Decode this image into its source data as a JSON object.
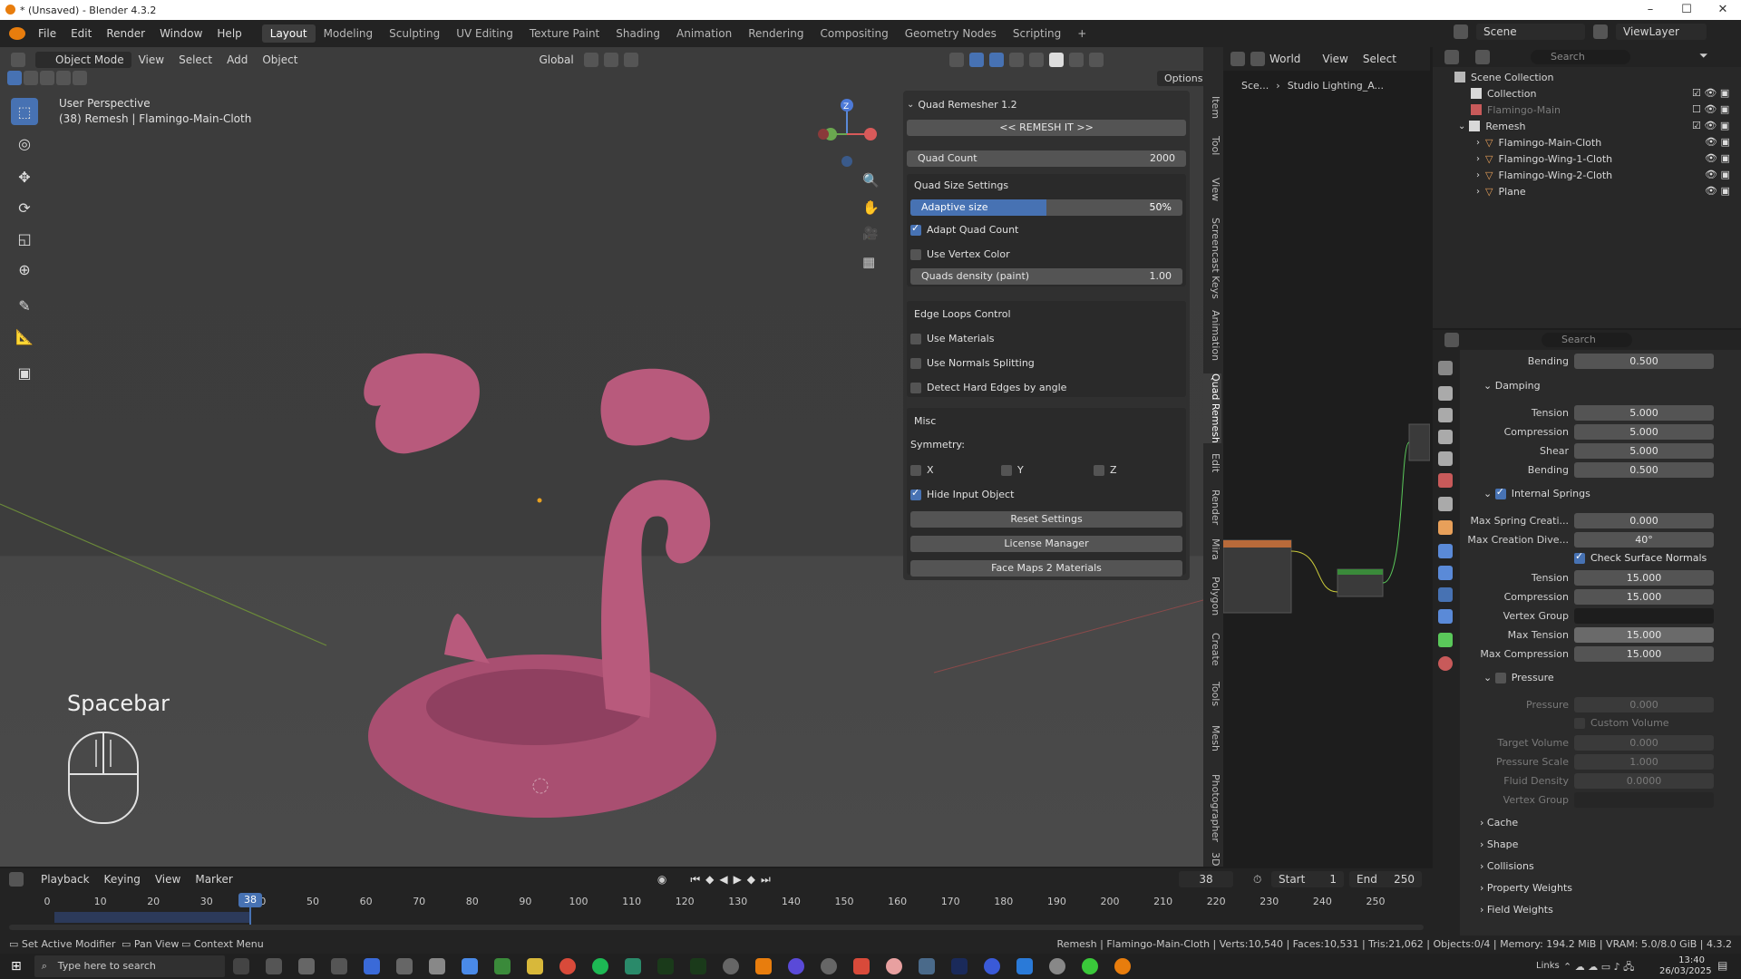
{
  "window": {
    "title": "* (Unsaved) - Blender 4.3.2"
  },
  "menus": [
    "File",
    "Edit",
    "Render",
    "Window",
    "Help"
  ],
  "workspaces": [
    "Layout",
    "Modeling",
    "Sculpting",
    "UV Editing",
    "Texture Paint",
    "Shading",
    "Animation",
    "Rendering",
    "Compositing",
    "Geometry Nodes",
    "Scripting"
  ],
  "scene": {
    "name": "Scene",
    "view_layer": "ViewLayer"
  },
  "viewport": {
    "mode": "Object Mode",
    "menus": [
      "View",
      "Select",
      "Add",
      "Object"
    ],
    "orientation": "Global",
    "options": "Options",
    "perspective": "User Perspective",
    "object_info": "(38) Remesh | Flamingo-Main-Cloth",
    "key_hint": "Spacebar"
  },
  "side_tabs": [
    "Item",
    "Tool",
    "View",
    "Screencast Keys",
    "Animation",
    "Quad Remesh",
    "Edit",
    "Render",
    "Mira",
    "Polygon",
    "Create",
    "Tools",
    "Mesh",
    "Photographer",
    "3D"
  ],
  "quad_remesher": {
    "title": "Quad Remesher 1.2",
    "remesh_button": "<< REMESH IT >>",
    "quad_count_label": "Quad Count",
    "quad_count_value": "2000",
    "size_settings_title": "Quad Size Settings",
    "adaptive_label": "Adaptive size",
    "adaptive_value": "50%",
    "adaptive_fraction": 0.5,
    "adapt_quad_count": "Adapt Quad Count",
    "use_vertex_color": "Use Vertex Color",
    "quads_density_label": "Quads density (paint)",
    "quads_density_value": "1.00",
    "edge_loops_title": "Edge Loops Control",
    "use_materials": "Use Materials",
    "use_normals_splitting": "Use Normals Splitting",
    "detect_hard_edges": "Detect Hard Edges by angle",
    "misc_title": "Misc",
    "symmetry_label": "Symmetry:",
    "sym_x": "X",
    "sym_y": "Y",
    "sym_z": "Z",
    "hide_input_object": "Hide Input Object",
    "reset_settings": "Reset Settings",
    "license_manager": "License Manager",
    "face_maps": "Face Maps 2 Materials"
  },
  "node_editor": {
    "world": "World",
    "menus": [
      "View",
      "Select"
    ],
    "breadcrumb_scene": "Sce...",
    "breadcrumb_world": "Studio Lighting_A..."
  },
  "outliner": {
    "search_placeholder": "Search",
    "scene_collection": "Scene Collection",
    "items": [
      {
        "name": "Collection",
        "depth": 1
      },
      {
        "name": "Flamingo-Main",
        "depth": 1
      },
      {
        "name": "Remesh",
        "depth": 1
      },
      {
        "name": "Flamingo-Main-Cloth",
        "depth": 2
      },
      {
        "name": "Flamingo-Wing-1-Cloth",
        "depth": 2
      },
      {
        "name": "Flamingo-Wing-2-Cloth",
        "depth": 2
      },
      {
        "name": "Plane",
        "depth": 2
      }
    ]
  },
  "properties": {
    "search_placeholder": "Search",
    "bending_top_label": "Bending",
    "bending_top_value": "0.500",
    "damping_title": "Damping",
    "damping": [
      {
        "label": "Tension",
        "value": "5.000"
      },
      {
        "label": "Compression",
        "value": "5.000"
      },
      {
        "label": "Shear",
        "value": "5.000"
      },
      {
        "label": "Bending",
        "value": "0.500"
      }
    ],
    "internal_springs_title": "Internal Springs",
    "max_spring_label": "Max Spring Creati...",
    "max_spring_value": "0.000",
    "max_creation_label": "Max Creation Dive...",
    "max_creation_value": "40°",
    "check_surface_normals": "Check Surface Normals",
    "springs": [
      {
        "label": "Tension",
        "value": "15.000"
      },
      {
        "label": "Compression",
        "value": "15.000"
      }
    ],
    "vertex_group_label": "Vertex Group",
    "max_tension_label": "Max Tension",
    "max_tension_value": "15.000",
    "max_compression_label": "Max Compression",
    "max_compression_value": "15.000",
    "pressure_title": "Pressure",
    "pressure_label": "Pressure",
    "pressure_value": "0.000",
    "custom_volume": "Custom Volume",
    "target_volume_label": "Target Volume",
    "target_volume_value": "0.000",
    "pressure_scale_label": "Pressure Scale",
    "pressure_scale_value": "1.000",
    "fluid_density_label": "Fluid Density",
    "fluid_density_value": "0.0000",
    "vertex_group2_label": "Vertex Group",
    "collapsed": [
      "Cache",
      "Shape",
      "Collisions",
      "Property Weights",
      "Field Weights"
    ]
  },
  "timeline": {
    "menus": [
      "Playback",
      "Keying",
      "View",
      "Marker"
    ],
    "current_frame": "38",
    "start_label": "Start",
    "start_value": "1",
    "end_label": "End",
    "end_value": "250",
    "ticks": [
      "0",
      "10",
      "20",
      "30",
      "40",
      "50",
      "60",
      "70",
      "80",
      "90",
      "100",
      "110",
      "120",
      "130",
      "140",
      "150",
      "160",
      "170",
      "180",
      "190",
      "200",
      "210",
      "220",
      "230",
      "240",
      "250"
    ]
  },
  "statusbar": {
    "left": [
      "Set Active Modifier",
      "Pan View",
      "Context Menu"
    ],
    "stats": "Remesh | Flamingo-Main-Cloth | Verts:10,540 | Faces:10,531 | Tris:21,062 | Objects:0/4 | Memory: 194.2 MiB | VRAM: 5.0/8.0 GiB | 4.3.2"
  },
  "taskbar": {
    "search_placeholder": "Type here to search",
    "links": "Links",
    "time": "13:40",
    "date": "26/03/2025"
  },
  "colors": {
    "accent": "#4772b3",
    "flamingo": "#b85a7c",
    "orange": "#e87d0d"
  }
}
